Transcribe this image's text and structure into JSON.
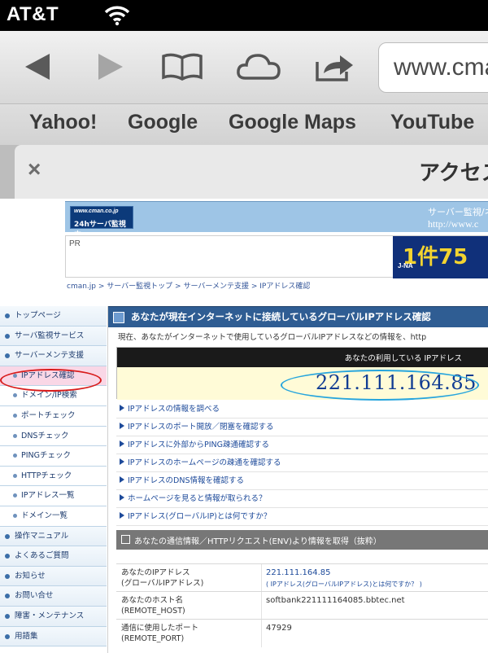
{
  "status_bar": {
    "carrier": "AT&T"
  },
  "toolbar": {
    "url": "www.cman.jp"
  },
  "bookmarks": [
    "Yahoo!",
    "Google",
    "Google Maps",
    "YouTube"
  ],
  "tab": {
    "close": "×",
    "title": "アクセス"
  },
  "banner": {
    "logo_line1": "www.cman.co.jp",
    "logo_line2": "24hサーバ監視中",
    "right_line1": "サーバー監視/ネ",
    "right_line2": "http://www.c"
  },
  "pr": {
    "label": "PR",
    "ad_big": "1件75",
    "ad_small": "J-NA"
  },
  "breadcrumb": "cman.jp > サーバー監視トップ > サーバーメンテ支援 > IPアドレス確認",
  "sidebar": [
    {
      "label": "トップページ",
      "type": "main"
    },
    {
      "label": "サーバ監視サービス",
      "type": "main"
    },
    {
      "label": "サーバーメンテ支援",
      "type": "main"
    },
    {
      "label": "IPアドレス確認",
      "type": "sub-active"
    },
    {
      "label": "ドメイン/IP検索",
      "type": "sub"
    },
    {
      "label": "ポートチェック",
      "type": "sub"
    },
    {
      "label": "DNSチェック",
      "type": "sub"
    },
    {
      "label": "PINGチェック",
      "type": "sub"
    },
    {
      "label": "HTTPチェック",
      "type": "sub"
    },
    {
      "label": "IPアドレス一覧",
      "type": "sub"
    },
    {
      "label": "ドメイン一覧",
      "type": "sub"
    },
    {
      "label": "操作マニュアル",
      "type": "main"
    },
    {
      "label": "よくあるご質問",
      "type": "main"
    },
    {
      "label": "お知らせ",
      "type": "main"
    },
    {
      "label": "お問い合せ",
      "type": "main"
    },
    {
      "label": "障害・メンテナンス",
      "type": "main"
    },
    {
      "label": "用語集",
      "type": "main"
    }
  ],
  "main": {
    "header": "あなたが現在インターネットに接続しているグローバルIPアドレス確認",
    "intro": "現在、あなたがインターネットで使用しているグローバルIPアドレスなどの情報を、http",
    "ip_label": "あなたの利用している IPアドレス",
    "ip_value": "221.111.164.85",
    "links": [
      "IPアドレスの情報を調べる",
      "IPアドレスのポート開放／閉塞を確認する",
      "IPアドレスに外部からPING疎通確認する",
      "IPアドレスのホームページの疎通を確認する",
      "IPアドレスのDNS情報を確認する",
      "ホームページを見ると情報が取られる？",
      "IPアドレス(グローバルIP)とは何ですか？"
    ],
    "env_header": "あなたの通信情報／HTTPリクエスト(ENV)より情報を取得（抜粋）",
    "table": [
      {
        "key": "あなたのIPアドレス\n(グローバルIPアドレス)",
        "value": "221.111.164.85",
        "note": "( IPアドレス(グローバルIPアドレス)とは何ですか？ )"
      },
      {
        "key": "あなたのホスト名\n(REMOTE_HOST)",
        "value": "softbank221111164085.bbtec.net"
      },
      {
        "key": "通信に使用したポート\n(REMOTE_PORT)",
        "value": "47929"
      }
    ]
  }
}
